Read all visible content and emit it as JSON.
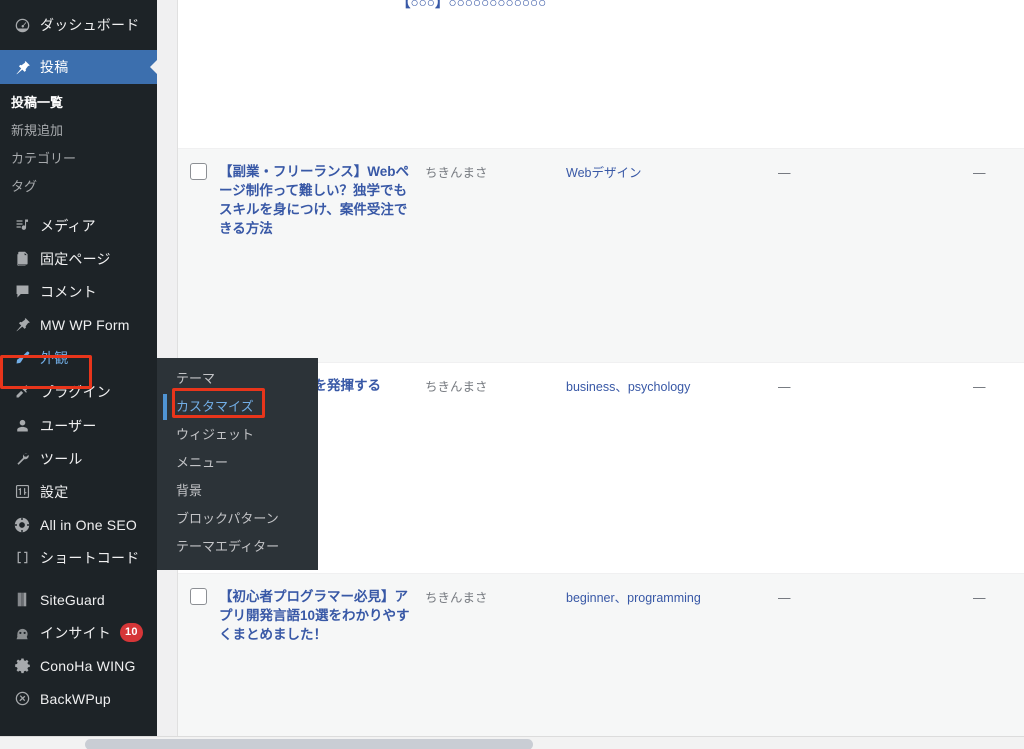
{
  "colors": {
    "sidebar_bg": "#1d2327",
    "submenu_bg": "#2c3338",
    "active_blue": "#3c6fae",
    "link_blue": "#3858a6",
    "highlight_blue": "#72aee6",
    "annotation_red": "#e8351b",
    "badge_red": "#d63638",
    "row_alt_bg": "#f6f7f7"
  },
  "sidebar": {
    "items": [
      {
        "label": "ダッシュボード",
        "icon": "dashboard-icon",
        "state": "normal"
      },
      {
        "label": "投稿",
        "icon": "pin-icon",
        "state": "current"
      },
      {
        "label": "メディア",
        "icon": "media-icon",
        "state": "normal"
      },
      {
        "label": "固定ページ",
        "icon": "pages-icon",
        "state": "normal"
      },
      {
        "label": "コメント",
        "icon": "comment-icon",
        "state": "normal"
      },
      {
        "label": "MW WP Form",
        "icon": "pin-icon",
        "state": "normal"
      },
      {
        "label": "外観",
        "icon": "brush-icon",
        "state": "open"
      },
      {
        "label": "プラグイン",
        "icon": "plugin-icon",
        "state": "normal"
      },
      {
        "label": "ユーザー",
        "icon": "user-icon",
        "state": "normal"
      },
      {
        "label": "ツール",
        "icon": "wrench-icon",
        "state": "normal"
      },
      {
        "label": "設定",
        "icon": "settings-icon",
        "state": "normal"
      },
      {
        "label": "All in One SEO",
        "icon": "aioseo-icon",
        "state": "normal"
      },
      {
        "label": "ショートコード",
        "icon": "brackets-icon",
        "state": "normal"
      },
      {
        "label": "SiteGuard",
        "icon": "siteguard-icon",
        "state": "normal"
      },
      {
        "label": "インサイト",
        "icon": "insight-icon",
        "state": "normal",
        "badge": "10"
      },
      {
        "label": "ConoHa WING",
        "icon": "gear-icon",
        "state": "normal"
      },
      {
        "label": "BackWPup",
        "icon": "backwpup-icon",
        "state": "normal"
      }
    ],
    "posts_submenu": [
      {
        "label": "投稿一覧",
        "current": true
      },
      {
        "label": "新規追加",
        "current": false
      },
      {
        "label": "カテゴリー",
        "current": false
      },
      {
        "label": "タグ",
        "current": false
      }
    ]
  },
  "appearance_flyout": {
    "items": [
      {
        "label": "テーマ",
        "current": false
      },
      {
        "label": "カスタマイズ",
        "current": true
      },
      {
        "label": "ウィジェット",
        "current": false
      },
      {
        "label": "メニュー",
        "current": false
      },
      {
        "label": "背景",
        "current": false
      },
      {
        "label": "ブロックパターン",
        "current": false
      },
      {
        "label": "テーマエディター",
        "current": false
      }
    ]
  },
  "clipped_row": {
    "title_fragment": "【○○○】○○○○○○○○○○○○"
  },
  "post_list": {
    "rows": [
      {
        "title": "【副業・フリーランス】Webページ制作って難しい？独学でもスキルを身につけ、案件受注できる方法",
        "author": "ちきんまさ",
        "categories": "Webデザイン",
        "tags": "—",
        "comments": "—"
      },
      {
        "title": "学】ビジネス果を発揮する",
        "author": "ちきんまさ",
        "categories": "business、psychology",
        "tags": "—",
        "comments": "—"
      },
      {
        "title": "【初心者プログラマー必見】アプリ開発言語10選をわかりやすくまとめました！",
        "author": "ちきんまさ",
        "categories": "beginner、programming",
        "tags": "—",
        "comments": "—"
      }
    ]
  },
  "scrollbar": {
    "orientation": "horizontal",
    "position_label": "horizontal-scrollbar"
  }
}
